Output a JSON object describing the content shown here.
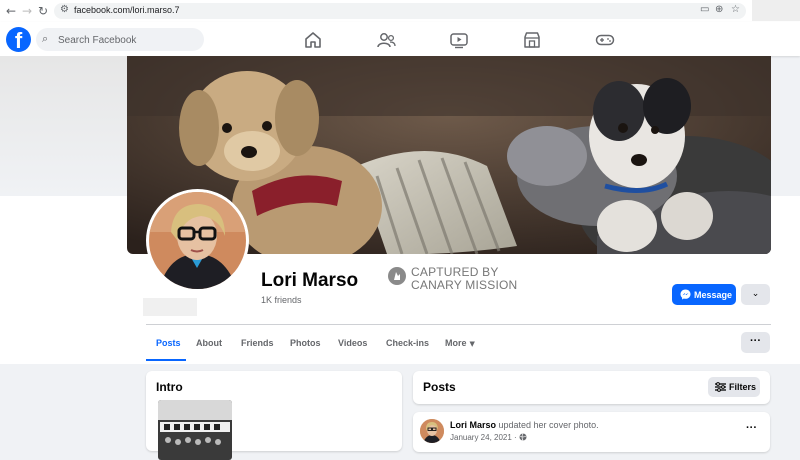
{
  "browser": {
    "url": "facebook.com/lori.marso.7",
    "icons": [
      "back-arrow-icon",
      "forward-arrow-icon",
      "reload-icon",
      "site-info-icon",
      "cast-icon",
      "zoom-icon",
      "bookmark-star-icon"
    ]
  },
  "header": {
    "logo_letter": "f",
    "search_placeholder": "Search Facebook",
    "nav_icons": [
      "home-icon",
      "friends-icon",
      "watch-icon",
      "marketplace-icon",
      "gaming-icon"
    ]
  },
  "profile": {
    "name": "Lori Marso",
    "friends_count": "1K friends",
    "watermark_line1": "CAPTURED BY",
    "watermark_line2": "CANARY MISSION"
  },
  "actions": {
    "message_label": "Message",
    "dropdown_icon": "chevron-down-icon"
  },
  "tabs": [
    {
      "label": "Posts",
      "active": true
    },
    {
      "label": "About"
    },
    {
      "label": "Friends"
    },
    {
      "label": "Photos"
    },
    {
      "label": "Videos"
    },
    {
      "label": "Check-ins"
    },
    {
      "label": "More"
    }
  ],
  "more_options_label": "···",
  "intro": {
    "title": "Intro"
  },
  "posts": {
    "title": "Posts",
    "filters_label": "Filters",
    "post": {
      "author": "Lori Marso",
      "action": " updated her cover photo.",
      "date": "January 24, 2021",
      "separator": " · ",
      "audience_icon": "globe-icon",
      "more_label": "···"
    }
  },
  "colors": {
    "brand": "#0866ff",
    "background": "#f0f2f5",
    "text_primary": "#050505",
    "text_secondary": "#65676b"
  }
}
